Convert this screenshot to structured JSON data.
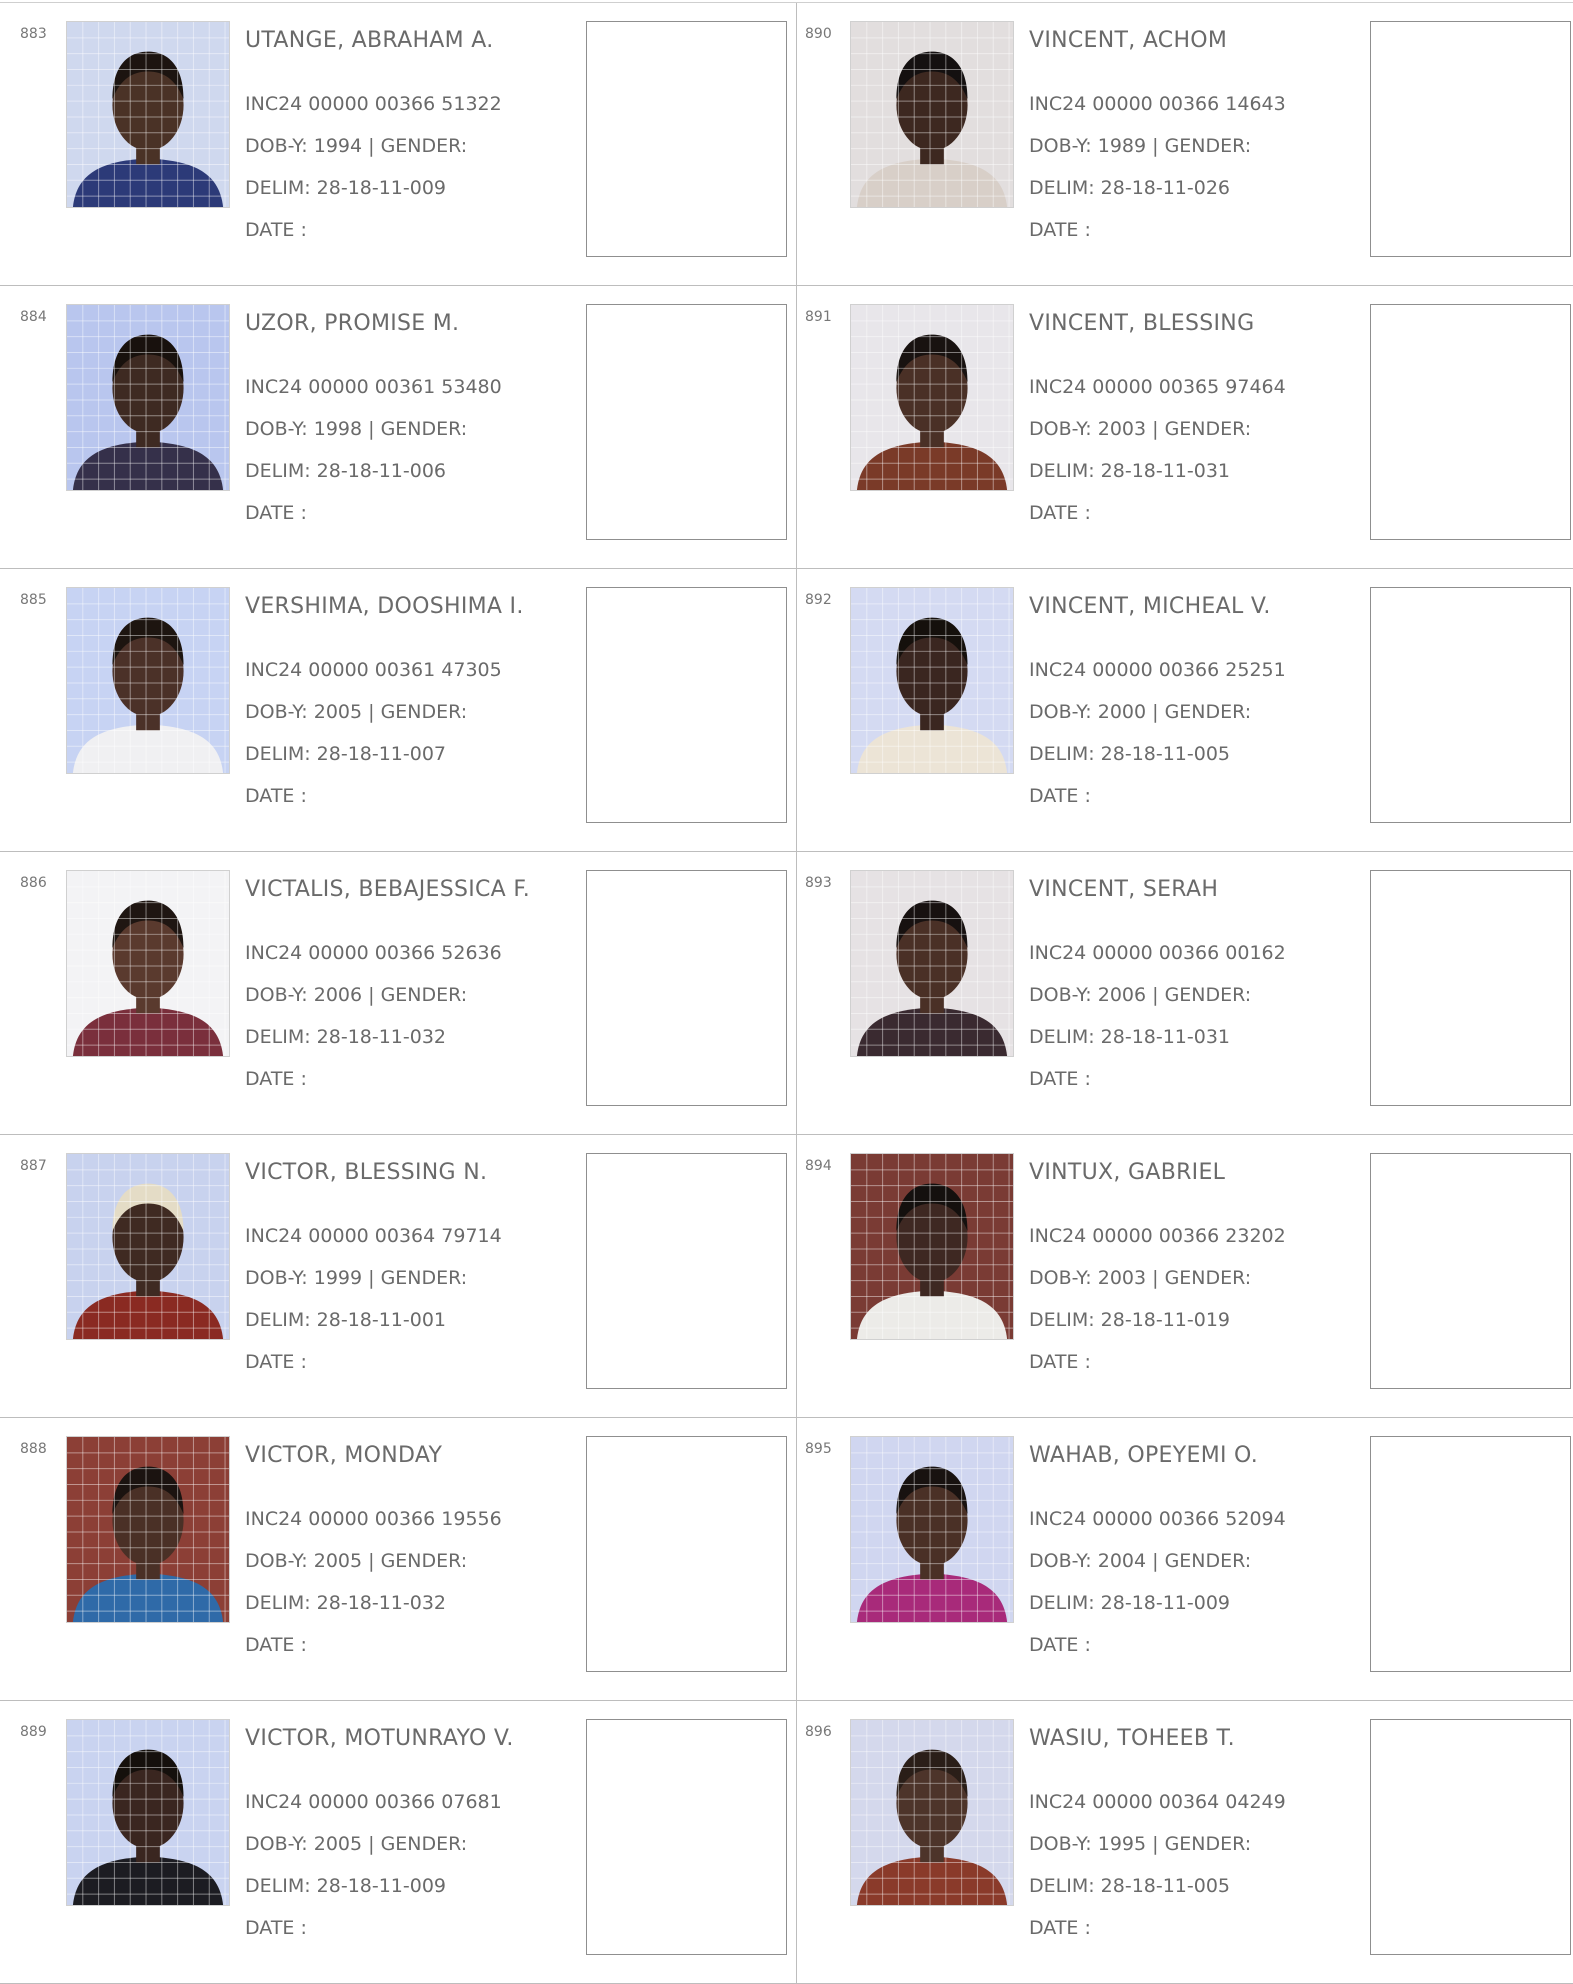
{
  "records": [
    {
      "serial": "883",
      "name": "UTANGE, ABRAHAM A.",
      "nin": "INC24 00000 00366 51322",
      "dob": "DOB-Y: 1994  | GENDER:",
      "delim": "DELIM: 28-18-11-009",
      "date": "DATE  :",
      "photo": {
        "bg": "#cfd8ee",
        "skin": "#4a3226",
        "hair": "#1c1410",
        "cloth": "#2c3a78"
      }
    },
    {
      "serial": "884",
      "name": "UZOR, PROMISE M.",
      "nin": "INC24 00000 00361 53480",
      "dob": "DOB-Y: 1998  | GENDER:",
      "delim": "DELIM: 28-18-11-006",
      "date": "DATE  :",
      "photo": {
        "bg": "#b9c6ee",
        "skin": "#3e2a22",
        "hair": "#18110d",
        "cloth": "#35304a"
      }
    },
    {
      "serial": "885",
      "name": "VERSHIMA, DOOSHIMA I.",
      "nin": "INC24 00000 00361 47305",
      "dob": "DOB-Y: 2005  | GENDER:",
      "delim": "DELIM: 28-18-11-007",
      "date": "DATE  :",
      "photo": {
        "bg": "#c7d3f3",
        "skin": "#4b3128",
        "hair": "#1d1510",
        "cloth": "#f0f0f2"
      }
    },
    {
      "serial": "886",
      "name": "VICTALIS, BEBAJESSICA F.",
      "nin": "INC24 00000 00366 52636",
      "dob": "DOB-Y: 2006  | GENDER:",
      "delim": "DELIM: 28-18-11-032",
      "date": "DATE  :",
      "photo": {
        "bg": "#f3f3f5",
        "skin": "#5a3a2e",
        "hair": "#1f1612",
        "cloth": "#7a2f3c"
      }
    },
    {
      "serial": "887",
      "name": "VICTOR, BLESSING N.",
      "nin": "INC24 00000 00364 79714",
      "dob": "DOB-Y: 1999  | GENDER:",
      "delim": "DELIM: 28-18-11-001",
      "date": "DATE  :",
      "photo": {
        "bg": "#c8d2ee",
        "skin": "#3f2a22",
        "hair": "#e4dcc6",
        "cloth": "#8a2a22"
      }
    },
    {
      "serial": "888",
      "name": "VICTOR, MONDAY",
      "nin": "INC24 00000 00366 19556",
      "dob": "DOB-Y: 2005  | GENDER:",
      "delim": "DELIM: 28-18-11-032",
      "date": "DATE  :",
      "photo": {
        "bg": "#8c3f36",
        "skin": "#4a3026",
        "hair": "#1b1310",
        "cloth": "#2f6aa8"
      }
    },
    {
      "serial": "889",
      "name": "VICTOR, MOTUNRAYO V.",
      "nin": "INC24 00000 00366 07681",
      "dob": "DOB-Y: 2005  | GENDER:",
      "delim": "DELIM: 28-18-11-009",
      "date": "DATE  :",
      "photo": {
        "bg": "#c9d3f0",
        "skin": "#3a2620",
        "hair": "#15100c",
        "cloth": "#1c1c22"
      }
    },
    {
      "serial": "890",
      "name": "VINCENT, ACHOM",
      "nin": "INC24 00000 00366 14643",
      "dob": "DOB-Y: 1989  | GENDER:",
      "delim": "DELIM: 28-18-11-026",
      "date": "DATE  :",
      "photo": {
        "bg": "#e2dede",
        "skin": "#3d2820",
        "hair": "#141010",
        "cloth": "#d8cfc8"
      }
    },
    {
      "serial": "891",
      "name": "VINCENT, BLESSING",
      "nin": "INC24 00000 00365 97464",
      "dob": "DOB-Y: 2003  | GENDER:",
      "delim": "DELIM: 28-18-11-031",
      "date": "DATE  :",
      "photo": {
        "bg": "#e8e6ea",
        "skin": "#4a3026",
        "hair": "#181210",
        "cloth": "#7a3a28"
      }
    },
    {
      "serial": "892",
      "name": "VINCENT, MICHEAL V.",
      "nin": "INC24 00000 00366 25251",
      "dob": "DOB-Y: 2000  | GENDER:",
      "delim": "DELIM: 28-18-11-005",
      "date": "DATE  :",
      "photo": {
        "bg": "#d4daf2",
        "skin": "#3a2620",
        "hair": "#15100c",
        "cloth": "#ece4d6"
      }
    },
    {
      "serial": "893",
      "name": "VINCENT, SERAH",
      "nin": "INC24 00000 00366 00162",
      "dob": "DOB-Y: 2006  | GENDER:",
      "delim": "DELIM: 28-18-11-031",
      "date": "DATE  :",
      "photo": {
        "bg": "#e6e2e4",
        "skin": "#4a3026",
        "hair": "#171110",
        "cloth": "#3a2a30"
      }
    },
    {
      "serial": "894",
      "name": "VINTUX, GABRIEL",
      "nin": "INC24 00000 00366 23202",
      "dob": "DOB-Y: 2003  | GENDER:",
      "delim": "DELIM: 28-18-11-019",
      "date": "DATE  :",
      "photo": {
        "bg": "#7a3b34",
        "skin": "#3e2822",
        "hair": "#14100e",
        "cloth": "#ecebe8"
      }
    },
    {
      "serial": "895",
      "name": "WAHAB, OPEYEMI O.",
      "nin": "INC24 00000 00366 52094",
      "dob": "DOB-Y: 2004  | GENDER:",
      "delim": "DELIM: 28-18-11-009",
      "date": "DATE  :",
      "photo": {
        "bg": "#d0d6f0",
        "skin": "#4a3026",
        "hair": "#181210",
        "cloth": "#a82a7a"
      }
    },
    {
      "serial": "896",
      "name": "WASIU, TOHEEB T.",
      "nin": "INC24 00000 00364 04249",
      "dob": "DOB-Y: 1995  | GENDER:",
      "delim": "DELIM: 28-18-11-005",
      "date": "DATE  :",
      "photo": {
        "bg": "#d4d8ec",
        "skin": "#4d342a",
        "hair": "#2a1e18",
        "cloth": "#8a3a2a"
      }
    }
  ]
}
